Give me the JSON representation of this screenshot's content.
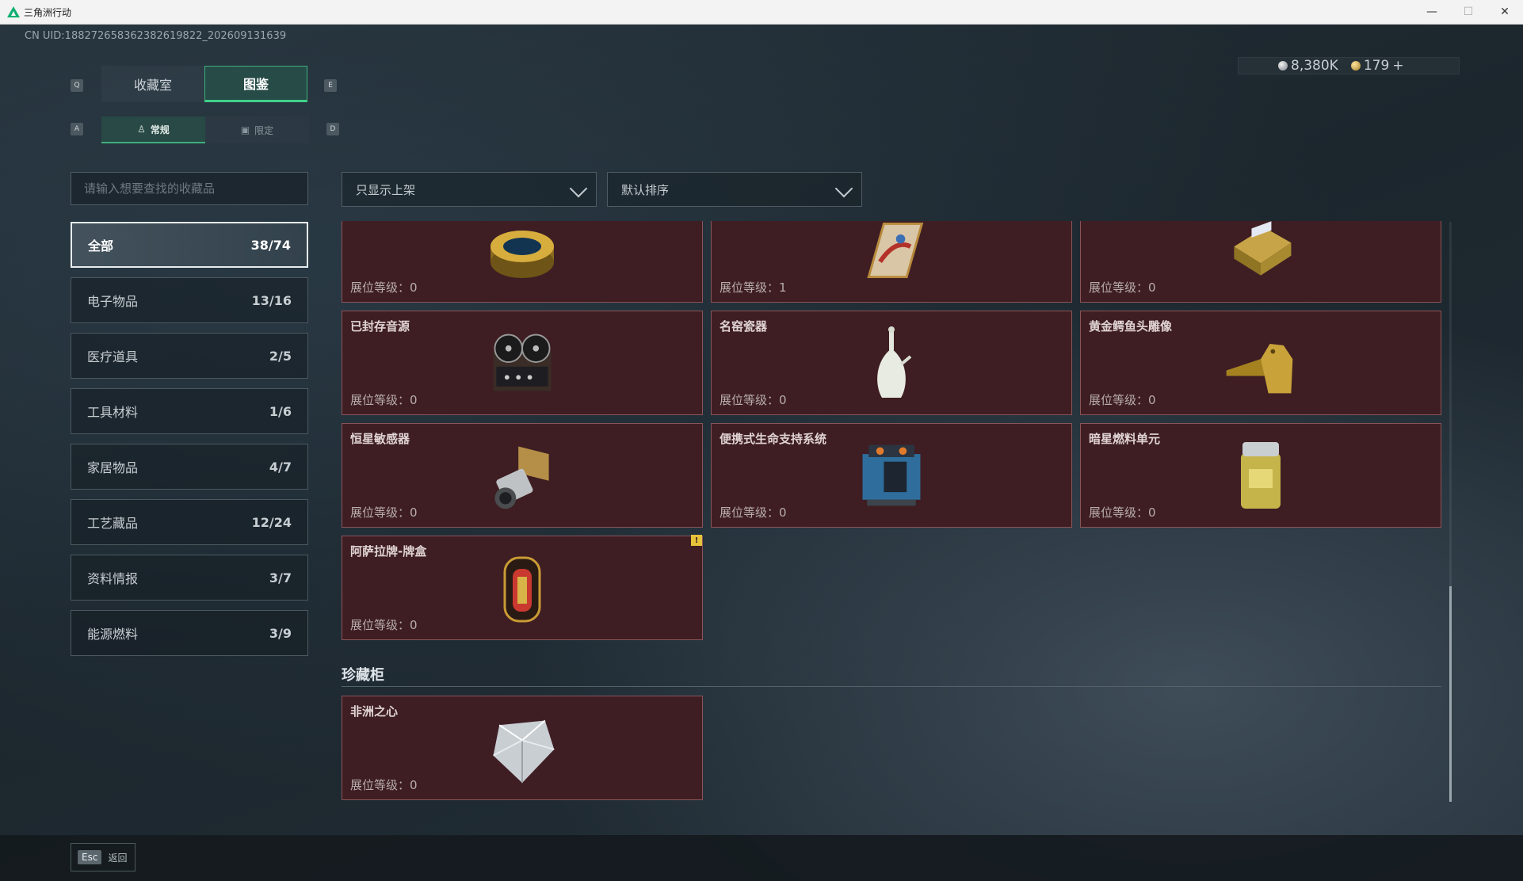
{
  "window": {
    "title": "三角洲行动",
    "minimize": "—",
    "maximize": "☐",
    "close": "✕"
  },
  "uid": "CN UID:18827265836238261982​2_202609131639",
  "currency": {
    "silver": "8,380K",
    "gold": "179",
    "plus": "+"
  },
  "key_hints": {
    "tab_prev": "Q",
    "tab_next": "E",
    "sub_prev": "A",
    "sub_next": "D"
  },
  "tabs": [
    {
      "label": "收藏室"
    },
    {
      "label": "图鉴"
    }
  ],
  "subtabs": [
    {
      "label": "常规"
    },
    {
      "label": "限定"
    }
  ],
  "search": {
    "placeholder": "请输入想要查找的收藏品"
  },
  "filter": {
    "value": "只显示上架"
  },
  "sort": {
    "value": "默认排序"
  },
  "categories": [
    {
      "label": "全部",
      "count": "38/74"
    },
    {
      "label": "电子物品",
      "count": "13/16"
    },
    {
      "label": "医疗道具",
      "count": "2/5"
    },
    {
      "label": "工具材料",
      "count": "1/6"
    },
    {
      "label": "家居物品",
      "count": "4/7"
    },
    {
      "label": "工艺藏品",
      "count": "12/24"
    },
    {
      "label": "资料情报",
      "count": "3/7"
    },
    {
      "label": "能源燃料",
      "count": "3/9"
    }
  ],
  "level_prefix": "展位等级：",
  "cards": [
    {
      "name": "",
      "level": "0",
      "icon": "caviar-tin-icon"
    },
    {
      "name": "",
      "level": "1",
      "icon": "ornate-card-icon"
    },
    {
      "name": "",
      "level": "0",
      "icon": "gold-device-icon"
    },
    {
      "name": "已封存音源",
      "level": "0",
      "icon": "tape-recorder-icon"
    },
    {
      "name": "名窑瓷器",
      "level": "0",
      "icon": "porcelain-vase-icon"
    },
    {
      "name": "黄金鳄鱼头雕像",
      "level": "0",
      "icon": "gold-crocodile-icon"
    },
    {
      "name": "恒星敏感器",
      "level": "0",
      "icon": "star-sensor-icon"
    },
    {
      "name": "便携式生命支持系统",
      "level": "0",
      "icon": "life-support-icon"
    },
    {
      "name": "暗星燃料单元",
      "level": "0",
      "icon": "fuel-cell-icon"
    },
    {
      "name": "阿萨拉牌-牌盒",
      "level": "0",
      "icon": "card-box-icon",
      "badge": "!"
    }
  ],
  "showcase": {
    "title": "珍藏柜",
    "cards": [
      {
        "name": "非洲之心",
        "level": "0",
        "icon": "diamond-icon"
      }
    ]
  },
  "footer": {
    "esc_key": "Esc",
    "esc_label": "返回"
  }
}
